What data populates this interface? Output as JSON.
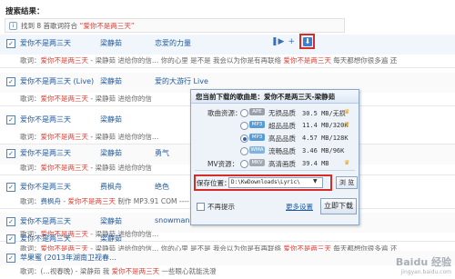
{
  "results_title": "搜索结果：",
  "found": {
    "prefix": "找到 8 首歌词符合",
    "keyword": "“爱你不是两三天”"
  },
  "rows": [
    {
      "song": "爱你不是两三天",
      "singer": "梁静茹",
      "album": "恋爱的力量",
      "lyric": {
        "label": "歌词：",
        "a": "爱你不是两三天",
        "b": " - 梁静茹 进给你的信…",
        "c": "你的心里 是不是 我会以为你是有再联络",
        "d": "爱你不是两三天",
        "e": " 每天都想你很多遍 还"
      }
    },
    {
      "song": "爱你不是两三天 (Live)",
      "singer": "梁静茹",
      "album": "爱的大游行 Live",
      "lyric": {
        "label": "歌词：",
        "a": "爱你不是两三天",
        "b": " - 梁静茹 进给你的信",
        "c": "…"
      }
    },
    {
      "song": "爱你不是两三天",
      "singer": "梁静茹",
      "album": "",
      "lyric": {
        "label": "歌词：",
        "a": "爱你不是两三天",
        "b": " - 梁静茹 进给你的信…",
        "c": ""
      }
    },
    {
      "song": "爱你不是两三天",
      "singer": "梁静茹",
      "album": "勇气",
      "lyric": {
        "label": "歌词：",
        "a": "爱你不是两三天",
        "b": " - 梁静茹 进给你的信",
        "c": ""
      }
    },
    {
      "song": "爱你不是两三天",
      "singer": "费枫舟",
      "album": "绝色",
      "lyric": {
        "label": "歌词：",
        "a": "费枫舟",
        "b": " - ",
        "c": "爱你不是两三天",
        "d": " 制作 MP3.91 COM ----"
      }
    },
    {
      "song": "爱你不是两三天",
      "singer": "梁静茹",
      "album": "snowman5151",
      "lyric": {
        "label": "歌词：",
        "a": "爱你不是两三天",
        "b": " - 梁静茹 进给你的信…",
        "c": ""
      }
    },
    {
      "song": "爱你不是两三天",
      "singer": "梁静茹",
      "album": "",
      "lyric": {
        "label": "歌词：",
        "a": "爱你不是两三天",
        "b": " - 梁静茹 进给你的信…",
        "c": "你的心里 是不是 我会以为你是有再联络",
        "d": "爱你不是两三天",
        "e": " 每天都想你很多遍 还"
      }
    },
    {
      "song": "苹果蜜 (2013年湖南卫视春…",
      "singer": "",
      "album": "",
      "lyric": {
        "label": "歌词：",
        "a": "(…视春晚)",
        "b": " - 梁静茹 我 ",
        "c": "爱你不是两三天",
        "d": " 一些眼心就能洗澄"
      }
    }
  ],
  "dialog": {
    "title_prefix": "您当前下载的歌曲是：",
    "title_song": "爱你不是两三天-梁静茹",
    "source_label": "歌曲资源：",
    "mv_label": "MV资源：",
    "options": [
      {
        "format": "APE",
        "quality": "无损品质",
        "size": "30.5 MB/无损",
        "selected": false,
        "color": "#9aa0a8",
        "crown": true
      },
      {
        "format": "MP3",
        "quality": "超品品质",
        "size": "11.4 MB/320K",
        "selected": false,
        "color": "#5b9bd5",
        "crown": true
      },
      {
        "format": "MP3",
        "quality": "高品品质",
        "size": "4.57 MB/128K",
        "selected": true,
        "color": "#5b9bd5",
        "crown": false
      },
      {
        "format": "WMA",
        "quality": "流畅品质",
        "size": "3.46 MB/96K",
        "selected": false,
        "color": "#7fb4e0",
        "crown": false
      },
      {
        "format": "MKV",
        "quality": "高清画质",
        "size": "39.4 MB",
        "selected": false,
        "color": "#a2a8b0",
        "crown": true
      }
    ],
    "save_label": "保存位置：",
    "save_path": "D:\\KwDownloads\\Lyric\\",
    "browse": "浏 览",
    "no_remind": "不再提示",
    "more_settings": "更多设置",
    "download_now": "立即下载"
  },
  "watermark": {
    "main": "Baidu 经验",
    "sub": "jingyan.baidu.com"
  }
}
